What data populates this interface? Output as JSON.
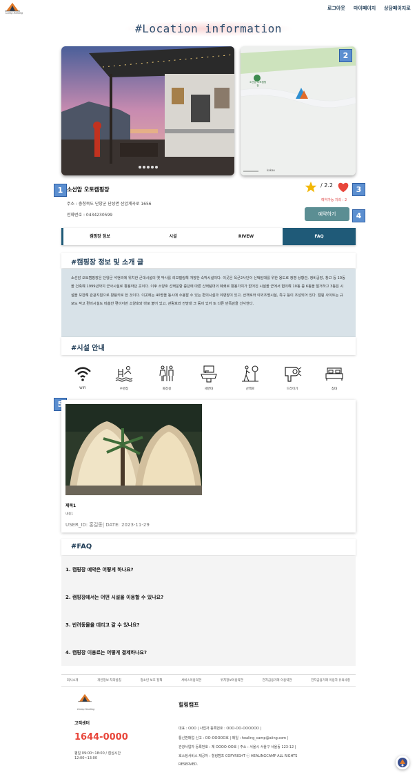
{
  "header": {
    "logo_text": "Camp Healing",
    "nav": [
      "로그아웃",
      "마이페이지",
      "상담페이지로"
    ]
  },
  "page_title": "#Location information",
  "gallery": {
    "badges": [
      "1",
      "2",
      "3",
      "4",
      "5"
    ],
    "map_label": "소선암 오토캠핑장",
    "map_scale": "kakao"
  },
  "camp": {
    "name": "소선암 오토캠핑장",
    "address": "주소 : 충청북도 단양군 단성면 선암계곡로 1656",
    "phone": "전화번호 : 0434230599",
    "rating": "/ 2.2",
    "distance": "예약가능 지리 : 2",
    "reserve_label": "예약하기"
  },
  "tabs": [
    "캠핑장 정보",
    "시설",
    "RIVEW",
    "FAQ"
  ],
  "intro": {
    "heading": "#캠핑장 정보 및 소개 글",
    "text": "소선암 오토캠핑장은 단양군 석현리에 위치한 군대시설의 옛 막사를 리모델링해 개장한 숙박시설이다. 이곳은 육군2사단이 신택탐대를 위한 용도로 정병 상황관, 정비공장, 창고 등 10동을 건축해 1999년까지 군사시설로 활용하던 곳이다. 이후 소양호 선택운항 중단에 따른 신택탐대의 폐쇄로 활용가치가 없어진 시설을 군에서 협의해 10동 중 6동을 철거하고 3동은 시설을 보완해 관광지원으로 활용키로 한 것이다. 이곳에는 40명을 동시에 수용할 수 있는 편의시설과 야영장이 있고, 산책로와 야외조명시설, 족구 등이 조성되어 있다. 캠핑 사이트는 규모도 작고 편의시설도 미흡한 편이지만 소양호와 바로 붙어 있고, 관람호와 전망대 크 등이 있어 또 다른 만족감을 선사한다."
  },
  "facilities": {
    "heading": "#시설 안내",
    "items": [
      {
        "label": "WIFI",
        "icon": "wifi-icon"
      },
      {
        "label": "수영장",
        "icon": "pool-icon"
      },
      {
        "label": "화장실",
        "icon": "restroom-icon"
      },
      {
        "label": "세면대",
        "icon": "sink-icon"
      },
      {
        "label": "산책로",
        "icon": "trail-icon"
      },
      {
        "label": "드라이기",
        "icon": "hairdryer-icon"
      },
      {
        "label": "침대",
        "icon": "bed-icon"
      }
    ]
  },
  "review": {
    "title": "제목1",
    "content": "내용1",
    "meta": "USER_ID: 홍길동| DATE: 2023-11-29"
  },
  "faq": {
    "heading": "#FAQ",
    "questions": [
      "1. 캠핑장 예약은 어떻게 하나요?",
      "2. 캠핑장에서는 어떤 시설을 이용할 수 있나요?",
      "3. 반려동물을 데리고 갈 수 있나요?",
      "4. 캠핑장 이용료는 어떻게 결제하나요?"
    ]
  },
  "footer": {
    "links": [
      "회사소개",
      "개인정보 처리방침",
      "청소년 보호 정책",
      "서비스이용약관",
      "위치정보이용약관",
      "전자금융거래 이용약관",
      "전자금융거래 이용자 유의사항"
    ],
    "cs_label": "고객센터",
    "cs_phone": "1644-0000",
    "cs_hours_1": "평일 09:00~18:00 / 점심시간",
    "cs_hours_2": "12:00~13:00",
    "company": "힐링캠프",
    "info_1": "대표 : OOO | 사업자 등록번호 : OOO-OO-OOOOOO |",
    "info_2": "통신판매업 신고 : OO-OOOOO호 | 메일 : healing_camp@aiing.com |",
    "info_3": "관광사업자 등록번호 : 제 OOOO-OO호 | 주소 : 서울시 서울구 서울동 123-12 |",
    "info_4": "호스팅서비스 제공자 : 힐링캠프 COPYRIGHT ⓒ HEALINGCAMP ALL RIGHTS",
    "info_5": "RESERVED."
  },
  "colors": {
    "primary": "#1f5a78",
    "accent_button": "#5b8e93",
    "cs_phone": "#e8463b",
    "badge": "#5c8fd0"
  }
}
